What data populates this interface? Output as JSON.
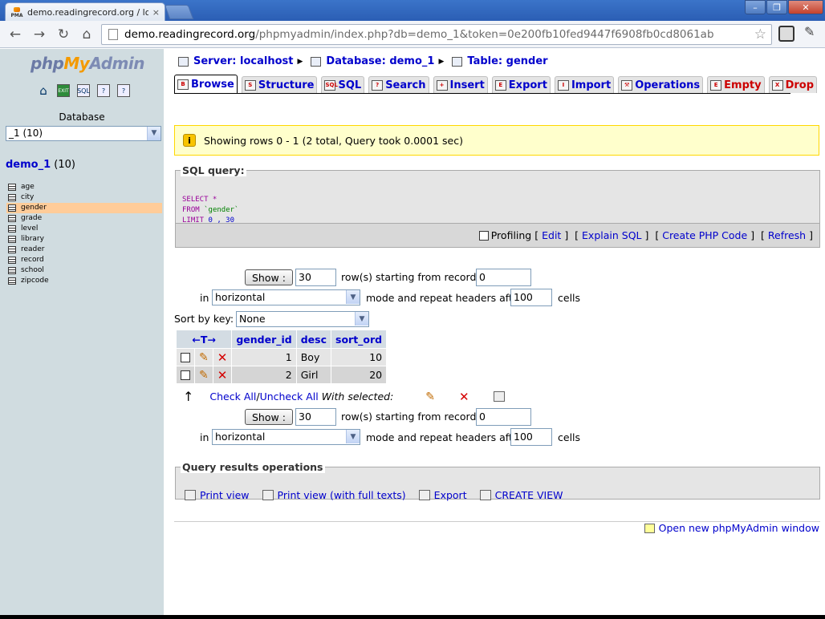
{
  "browser": {
    "tab_title": "demo.readingrecord.org / loc",
    "favicon_text": "PMA",
    "tab_close": "×",
    "url_host": "demo.readingrecord.org",
    "url_path": "/phpmyadmin/index.php?db=demo_1&token=0e200fb10fed9447f6908fb0cd8061ab",
    "nav_back": "←",
    "nav_forward": "→",
    "nav_reload": "↻",
    "nav_home": "⌂",
    "star": "☆",
    "wrench": "✎",
    "min": "–",
    "max": "❐",
    "close": "✕"
  },
  "sidebar": {
    "logo_php": "php",
    "logo_my": "My",
    "logo_admin": "Admin",
    "database_label": "Database",
    "database_select": "_1 (10)",
    "db_name": "demo_1",
    "db_count": " (10)",
    "tables": [
      {
        "name": "age",
        "active": false
      },
      {
        "name": "city",
        "active": false
      },
      {
        "name": "gender",
        "active": true
      },
      {
        "name": "grade",
        "active": false
      },
      {
        "name": "level",
        "active": false
      },
      {
        "name": "library",
        "active": false
      },
      {
        "name": "reader",
        "active": false
      },
      {
        "name": "record",
        "active": false
      },
      {
        "name": "school",
        "active": false
      },
      {
        "name": "zipcode",
        "active": false
      }
    ]
  },
  "breadcrumb": {
    "server": "Server: localhost",
    "database": "Database: demo_1",
    "table": "Table: gender"
  },
  "tabs": [
    {
      "label": "Browse",
      "icon": "B",
      "active": true,
      "danger": false
    },
    {
      "label": "Structure",
      "icon": "S",
      "active": false,
      "danger": false
    },
    {
      "label": "SQL",
      "icon": "SQL",
      "active": false,
      "danger": false
    },
    {
      "label": "Search",
      "icon": "?",
      "active": false,
      "danger": false
    },
    {
      "label": "Insert",
      "icon": "+",
      "active": false,
      "danger": false
    },
    {
      "label": "Export",
      "icon": "E",
      "active": false,
      "danger": false
    },
    {
      "label": "Import",
      "icon": "I",
      "active": false,
      "danger": false
    },
    {
      "label": "Operations",
      "icon": "⚒",
      "active": false,
      "danger": false
    },
    {
      "label": "Empty",
      "icon": "E",
      "active": false,
      "danger": true
    },
    {
      "label": "Drop",
      "icon": "X",
      "active": false,
      "danger": true
    }
  ],
  "notice": {
    "icon": "i",
    "text": "Showing rows 0 - 1 (2 total, Query took 0.0001 sec)"
  },
  "sql_query": {
    "legend": "SQL query:",
    "line1_kw": "SELECT",
    "line1_rest": " *",
    "line2_kw": "FROM",
    "line2_ident": " `gender`",
    "line3_kw": "LIMIT",
    "line3_num": " 0 , 30",
    "profiling": "Profiling",
    "links": [
      "Edit",
      "Explain SQL",
      "Create PHP Code",
      "Refresh"
    ]
  },
  "nav_top": {
    "show_label": "Show :",
    "rows_value": "30",
    "rows_text": "row(s) starting from record #",
    "start_value": "0",
    "in_text": "in",
    "mode_value": "horizontal",
    "mode_text": "mode and repeat headers after",
    "repeat_value": "100",
    "cells_text": "cells"
  },
  "sort": {
    "label": "Sort by key:",
    "value": "None"
  },
  "results": {
    "arrows": "←T→",
    "columns": [
      "gender_id",
      "desc",
      "sort_ord"
    ],
    "rows": [
      [
        "1",
        "Boy",
        "10"
      ],
      [
        "2",
        "Girl",
        "20"
      ]
    ],
    "edit_icon": "✎",
    "delete_icon": "✕"
  },
  "with_selected": {
    "arrow": "↑",
    "check_all": "Check All",
    "slash": " / ",
    "uncheck_all": "Uncheck All",
    "with_selected": "With selected:"
  },
  "nav_bottom": {
    "show_label": "Show :",
    "rows_value": "30",
    "rows_text": "row(s) starting from record #",
    "start_value": "0",
    "in_text": "in",
    "mode_value": "horizontal",
    "mode_text": "mode and repeat headers after",
    "repeat_value": "100",
    "cells_text": "cells"
  },
  "query_ops": {
    "legend": "Query results operations",
    "links": [
      "Print view",
      "Print view (with full texts)",
      "Export",
      "CREATE VIEW"
    ]
  },
  "footer": {
    "open_window": "Open new phpMyAdmin window"
  }
}
